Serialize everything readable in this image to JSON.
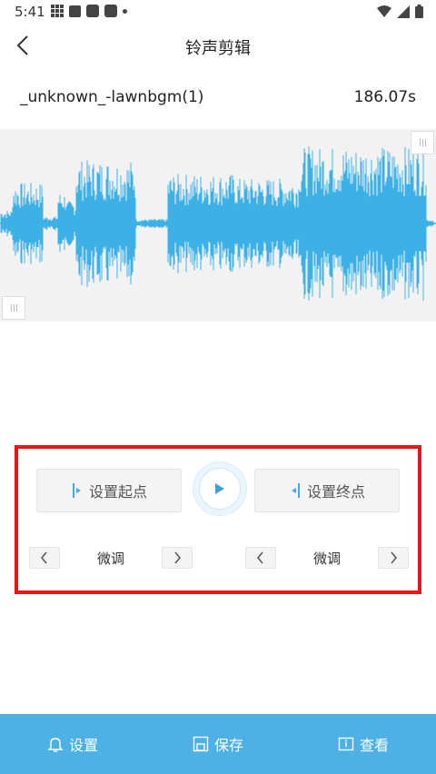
{
  "status": {
    "time": "5:41",
    "left_icons": [
      "grid-app-icon",
      "a-app-icon",
      "recorder-app-icon",
      "square-app-icon",
      "dot-icon"
    ],
    "right_icons": [
      "wifi-icon",
      "signal-icon",
      "battery-icon"
    ]
  },
  "header": {
    "title": "铃声剪辑",
    "back_icon": "chevron-left-icon"
  },
  "file": {
    "name": "_unknown_-lawnbgm(1)",
    "duration": "186.07s"
  },
  "waveform": {
    "color": "#3db1e6",
    "background": "#f2f2f2"
  },
  "controls": {
    "set_start_label": "设置起点",
    "set_end_label": "设置终点",
    "start_fine_label": "微调",
    "end_fine_label": "微调",
    "highlight_color": "#e8141b"
  },
  "bottom_bar": {
    "color": "#4db1e6",
    "settings_label": "设置",
    "save_label": "保存",
    "view_label": "查看"
  }
}
